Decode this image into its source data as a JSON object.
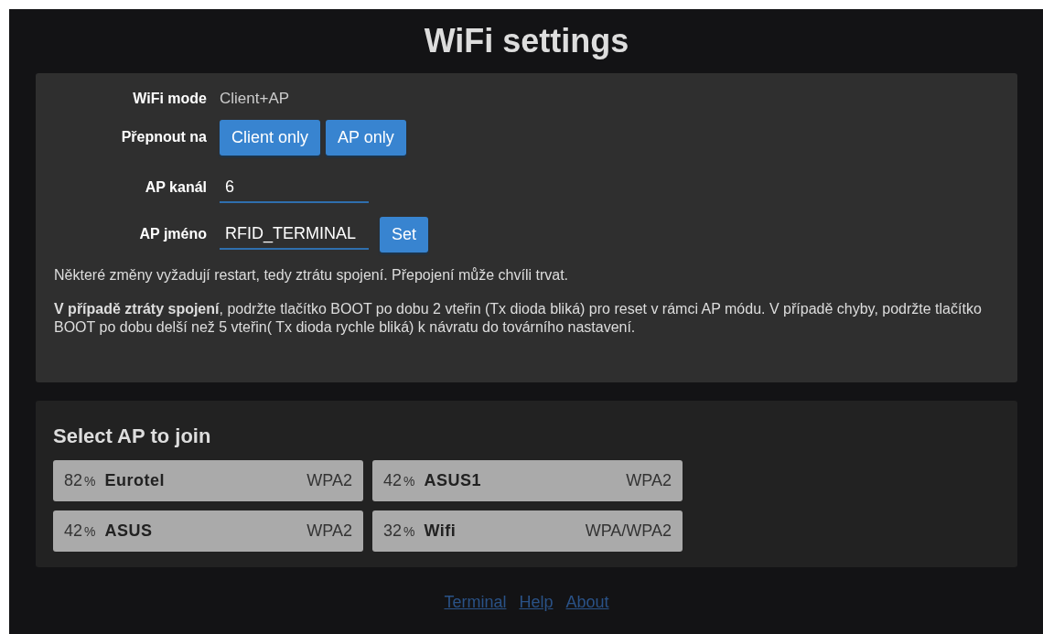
{
  "title": "WiFi settings",
  "settings": {
    "mode_label": "WiFi mode",
    "mode_value": "Client+AP",
    "switch_label": "Přepnout na",
    "switch_buttons": [
      "Client only",
      "AP only"
    ],
    "channel_label": "AP kanál",
    "channel_value": "6",
    "name_label": "AP jméno",
    "name_value": "RFID_TERMINAL",
    "set_button": "Set",
    "notes": [
      "Některé změny vyžadují restart, tedy ztrátu spojení. Přepojení může chvíli trvat.",
      "**V případě ztráty spojení**, podržte tlačítko BOOT po dobu 2 vteřin (Tx dioda bliká) pro reset v rámci AP módu. V případě chyby, podržte tlačítko BOOT po dobu delší než 5 vteřin( Tx dioda rychle bliká) k návratu do továrního nastavení."
    ]
  },
  "ap_list": {
    "title": "Select AP to join",
    "items": [
      {
        "signal": "82",
        "unit": "%",
        "name": "Eurotel",
        "security": "WPA2"
      },
      {
        "signal": "42",
        "unit": "%",
        "name": "ASUS1",
        "security": "WPA2"
      },
      {
        "signal": "42",
        "unit": "%",
        "name": "ASUS",
        "security": "WPA2"
      },
      {
        "signal": "32",
        "unit": "%",
        "name": "Wifi",
        "security": "WPA/WPA2"
      }
    ]
  },
  "footer_links": [
    "Terminal",
    "Help",
    "About"
  ]
}
